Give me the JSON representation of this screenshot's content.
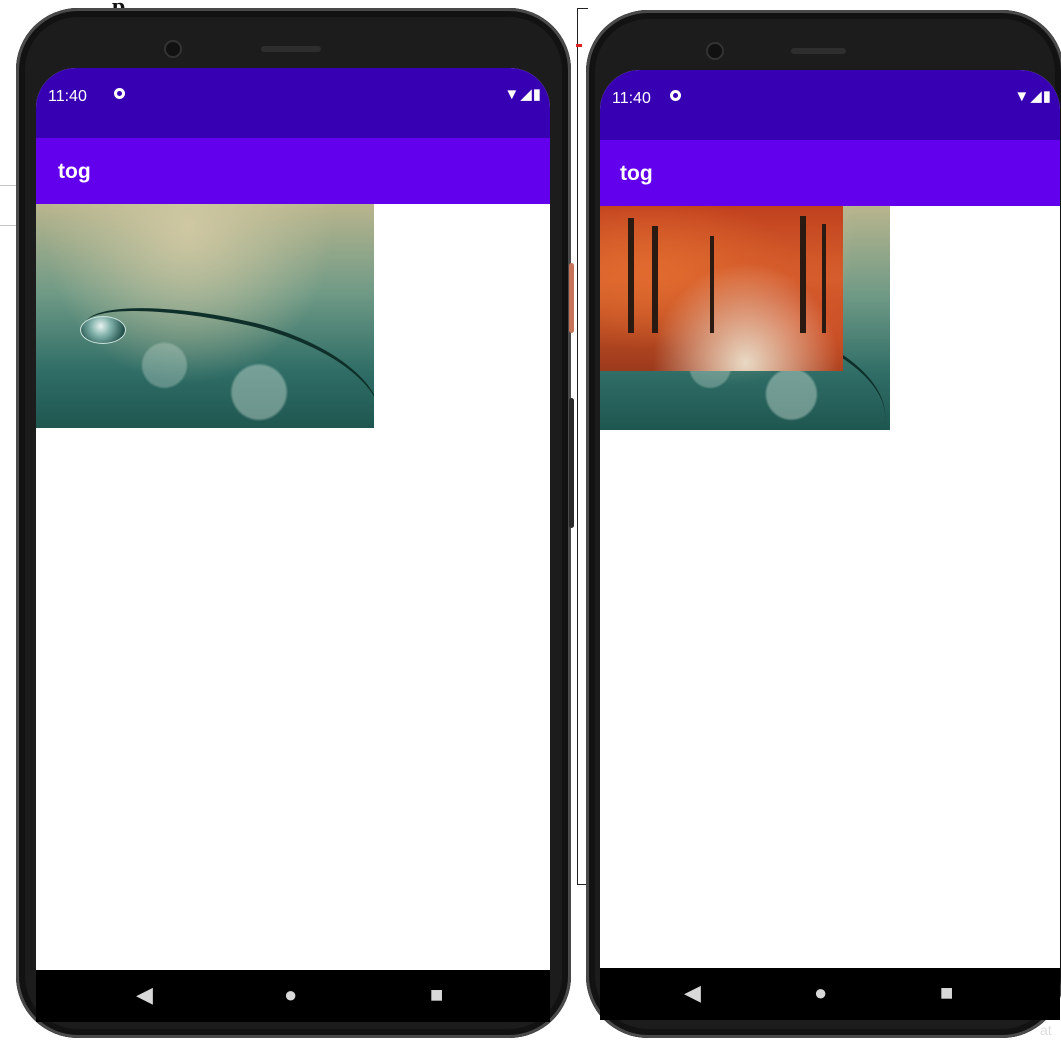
{
  "background": {
    "heading_fragment": "p"
  },
  "left_phone": {
    "status_time": "11:40",
    "status_icons": "▼◢▮",
    "app_title": "tog",
    "image": {
      "name": "water-drop-photo"
    },
    "nav": {
      "back": "◀",
      "home": "●",
      "recents": "■"
    }
  },
  "right_phone": {
    "status_time": "11:40",
    "status_icons": "▼◢▮",
    "app_title": "tog",
    "images": [
      {
        "name": "water-drop-photo"
      },
      {
        "name": "autumn-forest-photo"
      }
    ],
    "nav": {
      "back": "◀",
      "home": "●",
      "recents": "■"
    }
  },
  "corner_text": "at",
  "colors": {
    "status_bar": "#3700B3",
    "app_bar": "#6200EE",
    "screen": "#ffffff",
    "nav_bar": "#000000"
  }
}
